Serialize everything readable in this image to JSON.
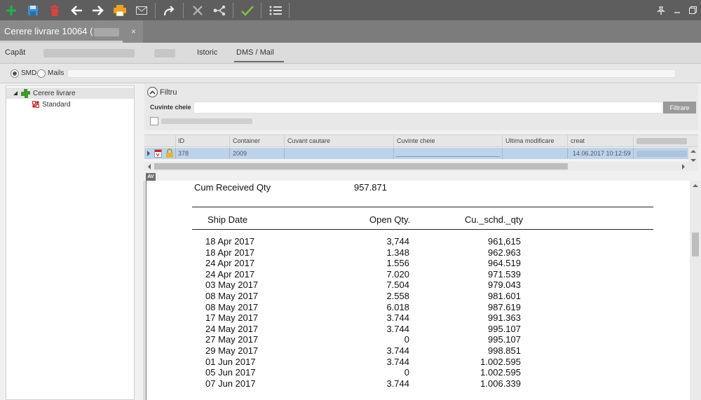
{
  "toolbar": {
    "buttons": [
      "add-icon",
      "save-icon",
      "delete-icon",
      "back-icon",
      "forward-icon",
      "print-icon",
      "mail-icon",
      "redirect-icon",
      "cancel-icon",
      "share-icon",
      "confirm-icon",
      "list-icon"
    ],
    "window_buttons": [
      "pin-icon",
      "minimize-icon",
      "restore-icon"
    ]
  },
  "doc_tab": {
    "title": "Cerere livrare 10064 (",
    "close": "×"
  },
  "subtabs": {
    "header": "Capăt",
    "history": "Istoric",
    "dms": "DMS / Mail"
  },
  "radio": {
    "smd": "SMD",
    "mails": "Mails"
  },
  "tree": {
    "root": "Cerere livrare",
    "child": "Standard"
  },
  "filter": {
    "title": "Filtru",
    "keywords_label": "Cuvinte cheie",
    "keywords_value": "",
    "button": "Filtrare"
  },
  "grid": {
    "columns": [
      "ID",
      "Container",
      "Cuvant cautare",
      "Cuvinte cheie",
      "Ultima modificare",
      "creat"
    ],
    "row": {
      "id": "378",
      "container": "2009",
      "search_word": "",
      "keywords": "",
      "last_modified": "",
      "created": "14.06.2017 10:12:59"
    }
  },
  "av_label": "AV",
  "report": {
    "cum_label": "Cum Received Qty",
    "cum_value": "957.871",
    "headers": {
      "ship_date": "Ship Date",
      "open_qty": "Open Qty.",
      "cu_schd": "Cu._schd._qty"
    },
    "rows": [
      {
        "date": "18 Apr 2017",
        "open": "3,744",
        "cum": "961,615"
      },
      {
        "date": "18 Apr 2017",
        "open": "1.348",
        "cum": "962.963"
      },
      {
        "date": "24 Apr 2017",
        "open": "1.556",
        "cum": "964.519"
      },
      {
        "date": "24 Apr 2017",
        "open": "7.020",
        "cum": "971.539"
      },
      {
        "date": "03 May 2017",
        "open": "7.504",
        "cum": "979.043"
      },
      {
        "date": "08 May 2017",
        "open": "2.558",
        "cum": "981.601"
      },
      {
        "date": "08 May 2017",
        "open": "6.018",
        "cum": "987.619"
      },
      {
        "date": "17 May 2017",
        "open": "3.744",
        "cum": "991.363"
      },
      {
        "date": "24 May 2017",
        "open": "3.744",
        "cum": "995.107"
      },
      {
        "date": "27 May 2017",
        "open": "0",
        "cum": "995.107"
      },
      {
        "date": "29 May 2017",
        "open": "3.744",
        "cum": "998.851"
      },
      {
        "date": "01 Jun 2017",
        "open": "3.744",
        "cum": "1.002.595"
      },
      {
        "date": "05 Jun 2017",
        "open": "0",
        "cum": "1.002.595"
      },
      {
        "date": "07 Jun 2017",
        "open": "3.744",
        "cum": "1.006.339"
      }
    ]
  },
  "colors": {
    "toolbar_bg": "#5e5e5e",
    "add_green": "#22b14c",
    "save_blue": "#3c8fd6",
    "delete_red": "#e04040",
    "print_orange": "#f0a020",
    "confirm_green": "#7dc242",
    "selected_row": "#bcd3ea"
  }
}
